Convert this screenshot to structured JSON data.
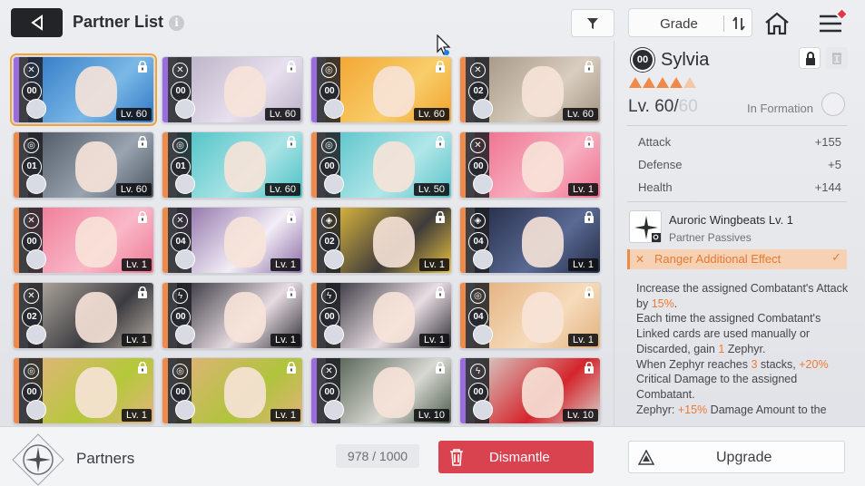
{
  "header": {
    "title": "Partner List",
    "info_icon": "i",
    "sort_label": "Grade"
  },
  "cards": [
    {
      "level_badge": "00",
      "lv": "Lv. 60",
      "class": "✕",
      "rarity": "purple",
      "colors": [
        "#2e77c4",
        "#7ab8e6"
      ]
    },
    {
      "level_badge": "00",
      "lv": "Lv. 60",
      "class": "✕",
      "rarity": "purple",
      "colors": [
        "#b8b0c4",
        "#e8e0ee"
      ]
    },
    {
      "level_badge": "00",
      "lv": "Lv. 60",
      "class": "◎",
      "rarity": "purple",
      "colors": [
        "#f2a22c",
        "#f8cd6a"
      ]
    },
    {
      "level_badge": "02",
      "lv": "Lv. 60",
      "class": "✕",
      "rarity": "orange",
      "colors": [
        "#a39382",
        "#d8cdbf"
      ]
    },
    {
      "level_badge": "01",
      "lv": "Lv. 60",
      "class": "◎",
      "rarity": "orange",
      "colors": [
        "#4a5360",
        "#9aa4b0"
      ]
    },
    {
      "level_badge": "01",
      "lv": "Lv. 60",
      "class": "◎",
      "rarity": "orange",
      "colors": [
        "#49c1c4",
        "#a9e3e5"
      ]
    },
    {
      "level_badge": "00",
      "lv": "Lv. 50",
      "class": "◎",
      "rarity": "orange",
      "colors": [
        "#57c3c9",
        "#b1e6e8"
      ]
    },
    {
      "level_badge": "00",
      "lv": "Lv. 1",
      "class": "✕",
      "rarity": "orange",
      "colors": [
        "#ee6d8b",
        "#f8b1c2"
      ]
    },
    {
      "level_badge": "00",
      "lv": "Lv. 1",
      "class": "✕",
      "rarity": "orange",
      "colors": [
        "#ef7894",
        "#f9b8c8"
      ]
    },
    {
      "level_badge": "04",
      "lv": "Lv. 1",
      "class": "✕",
      "rarity": "orange",
      "colors": [
        "#8a6aa4",
        "#f2eef6"
      ]
    },
    {
      "level_badge": "02",
      "lv": "Lv. 1",
      "class": "◈",
      "rarity": "orange",
      "colors": [
        "#e8c23e",
        "#3f3b3a"
      ]
    },
    {
      "level_badge": "04",
      "lv": "Lv. 1",
      "class": "◈",
      "rarity": "orange",
      "colors": [
        "#232a44",
        "#5a6a94"
      ]
    },
    {
      "level_badge": "02",
      "lv": "Lv. 1",
      "class": "✕",
      "rarity": "orange",
      "colors": [
        "#b8b0a6",
        "#3c3c40"
      ]
    },
    {
      "level_badge": "00",
      "lv": "Lv. 1",
      "class": "ϟ",
      "rarity": "orange",
      "colors": [
        "#2d2c36",
        "#e6dbe0"
      ]
    },
    {
      "level_badge": "00",
      "lv": "Lv. 1",
      "class": "ϟ",
      "rarity": "orange",
      "colors": [
        "#2c2b35",
        "#e8dde2"
      ]
    },
    {
      "level_badge": "04",
      "lv": "Lv. 1",
      "class": "◎",
      "rarity": "orange",
      "colors": [
        "#e2b07c",
        "#f6dcbc"
      ]
    },
    {
      "level_badge": "00",
      "lv": "Lv. 1",
      "class": "◎",
      "rarity": "orange",
      "colors": [
        "#e4b47e",
        "#b4c83a"
      ]
    },
    {
      "level_badge": "00",
      "lv": "Lv. 1",
      "class": "◎",
      "rarity": "orange",
      "colors": [
        "#e2b27c",
        "#b0c43c"
      ]
    },
    {
      "level_badge": "00",
      "lv": "Lv. 10",
      "class": "✕",
      "rarity": "purple",
      "colors": [
        "#4a5a4a",
        "#d8d8d2"
      ]
    },
    {
      "level_badge": "00",
      "lv": "Lv. 10",
      "class": "ϟ",
      "rarity": "purple",
      "colors": [
        "#d8d4cf",
        "#d4252c"
      ]
    }
  ],
  "detail": {
    "badge": "00",
    "name": "Sylvia",
    "stars_total": 5,
    "stars_filled": 4,
    "level": "Lv. 60/",
    "level_max": "60",
    "formation_label": "In Formation",
    "stats": [
      {
        "label": "Attack",
        "value": "+155"
      },
      {
        "label": "Defense",
        "value": "+5"
      },
      {
        "label": "Health",
        "value": "+144"
      }
    ],
    "skill_name": "Auroric Wingbeats Lv. 1",
    "skill_sub": "Partner Passives",
    "effect_label": "Ranger Additional Effect",
    "desc_1a": "Increase the assigned Combatant's Attack by ",
    "desc_1b": "15%",
    "desc_1c": ".",
    "desc_2a": "Each time the assigned Combatant's Linked cards are used manually or Discarded, gain ",
    "desc_2b": "1",
    "desc_2c": " Zephyr.",
    "desc_3a": "When Zephyr reaches ",
    "desc_3b": "3",
    "desc_3c": " stacks, ",
    "desc_3d": "+20%",
    "desc_3e": " Critical Damage to the assigned Combatant.",
    "desc_4a": "Zephyr: ",
    "desc_4b": "+15%",
    "desc_4c": " Damage Amount to the assigned Combatant's Passive Attack"
  },
  "bottom": {
    "partners_label": "Partners",
    "count": "978 / 1000",
    "dismantle_label": "Dismantle",
    "upgrade_label": "Upgrade"
  },
  "colors": {
    "accent_orange": "#ee8a4a",
    "dismantle_red": "#d8434f",
    "selected_outline": "#f0a43a"
  }
}
